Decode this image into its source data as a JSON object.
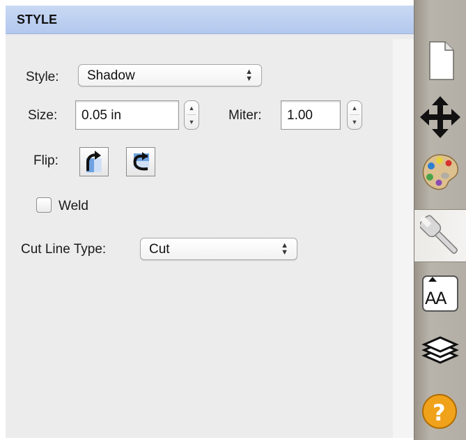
{
  "panel": {
    "title": "STYLE"
  },
  "style_row": {
    "label": "Style:",
    "selected": "Shadow"
  },
  "size_row": {
    "label": "Size:",
    "value": "0.05 in"
  },
  "miter_row": {
    "label": "Miter:",
    "value": "1.00"
  },
  "flip_row": {
    "label": "Flip:"
  },
  "weld": {
    "label": "Weld",
    "checked": false
  },
  "cut_line": {
    "label": "Cut Line Type:",
    "selected": "Cut"
  },
  "sidebar": {
    "tabs": [
      {
        "icon": "page-icon",
        "active": false
      },
      {
        "icon": "move-arrows-icon",
        "active": false
      },
      {
        "icon": "palette-icon",
        "active": false
      },
      {
        "icon": "wrench-icon",
        "active": true
      },
      {
        "icon": "text-size-icon",
        "active": false,
        "text": "AA"
      },
      {
        "icon": "layers-icon",
        "active": false
      },
      {
        "icon": "help-icon",
        "active": false,
        "text": "?"
      }
    ]
  },
  "colors": {
    "header_blue": "#b3c8ee",
    "panel_bg": "#ececec",
    "sidebar_bg": "#b3aea5",
    "help_orange": "#f0a21b"
  }
}
